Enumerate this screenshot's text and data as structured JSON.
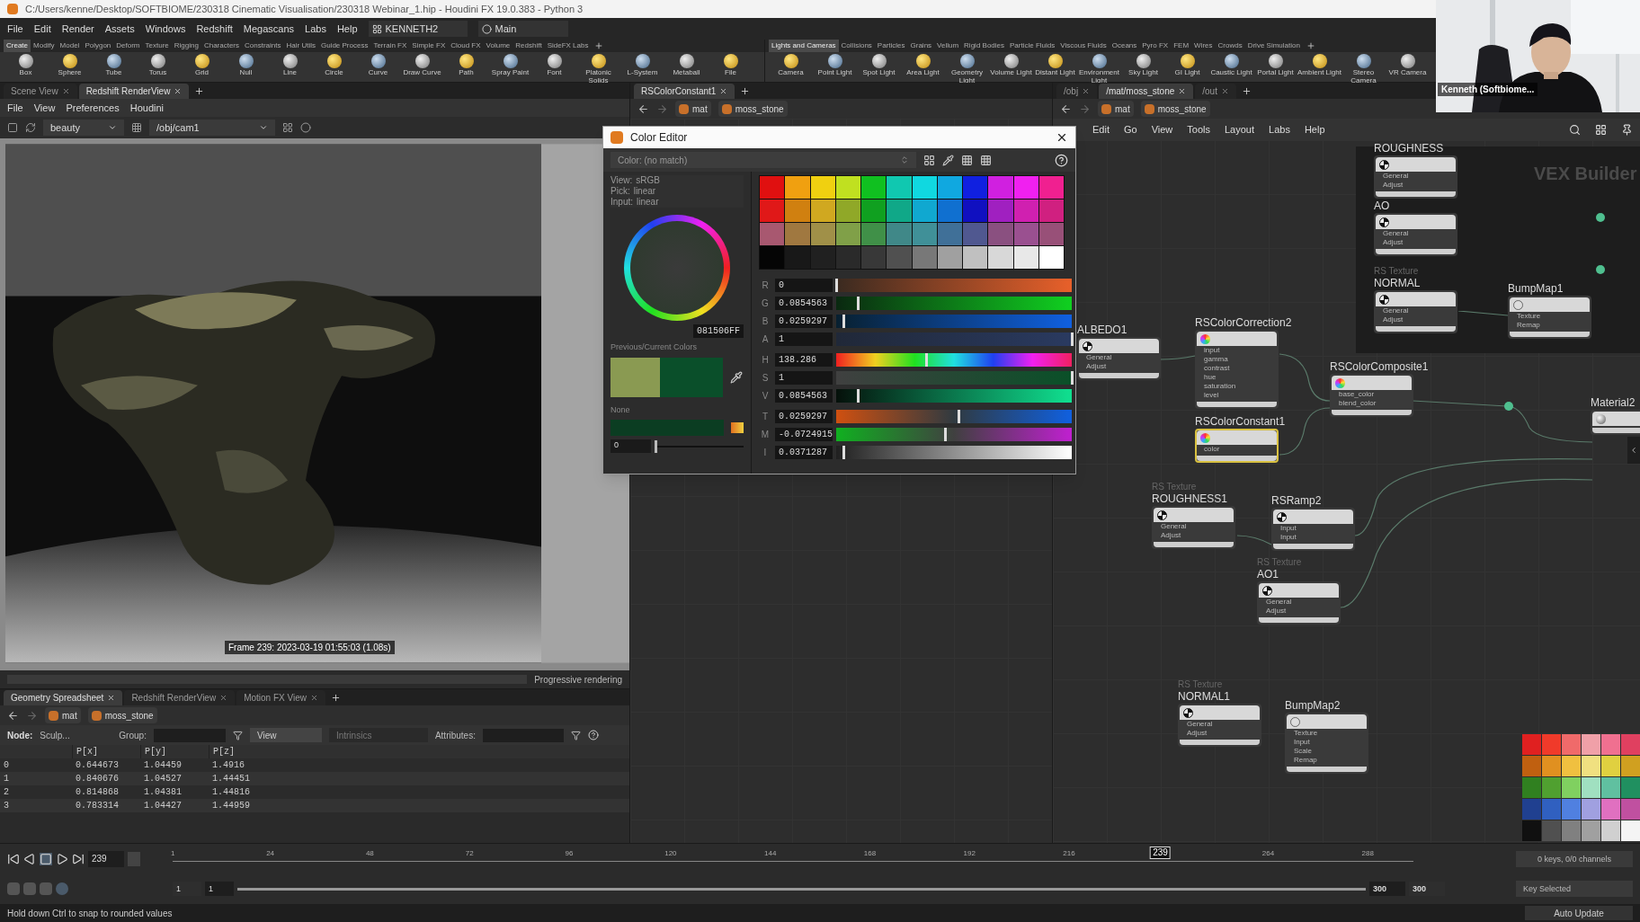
{
  "title_bar": {
    "title": "C:/Users/kenne/Desktop/SOFTBIOME/230318 Cinematic Visualisation/230318 Webinar_1.hip - Houdini FX 19.0.383 - Python 3"
  },
  "menu_bar": {
    "items": [
      "File",
      "Edit",
      "Render",
      "Assets",
      "Windows",
      "Redshift",
      "Megascans",
      "Labs",
      "Help"
    ],
    "desktop": "KENNETH2",
    "layout": "Main"
  },
  "shelf_left": {
    "tabs": [
      {
        "label": "Create",
        "selected": true
      },
      {
        "label": "Modify",
        "selected": false
      },
      {
        "label": "Model",
        "selected": false
      },
      {
        "label": "Polygon",
        "selected": false
      },
      {
        "label": "Deform",
        "selected": false
      },
      {
        "label": "Texture",
        "selected": false
      },
      {
        "label": "Rigging",
        "selected": false
      },
      {
        "label": "Characters",
        "selected": false
      },
      {
        "label": "Constraints",
        "selected": false
      },
      {
        "label": "Hair Utils",
        "selected": false
      },
      {
        "label": "Guide Process",
        "selected": false
      },
      {
        "label": "Terrain FX",
        "selected": false
      },
      {
        "label": "Simple FX",
        "selected": false
      },
      {
        "label": "Cloud FX",
        "selected": false
      },
      {
        "label": "Volume",
        "selected": false
      },
      {
        "label": "Redshift",
        "selected": false
      },
      {
        "label": "SideFX Labs",
        "selected": false
      }
    ],
    "tools": [
      "Box",
      "Sphere",
      "Tube",
      "Torus",
      "Grid",
      "Null",
      "Line",
      "Circle",
      "Curve",
      "Draw Curve",
      "Path",
      "Spray Paint",
      "Font",
      "Platonic Solids",
      "L-System",
      "Metaball",
      "File"
    ]
  },
  "shelf_right": {
    "tabs": [
      {
        "label": "Lights and Cameras",
        "selected": true
      },
      {
        "label": "Collisions",
        "selected": false
      },
      {
        "label": "Particles",
        "selected": false
      },
      {
        "label": "Grains",
        "selected": false
      },
      {
        "label": "Vellum",
        "selected": false
      },
      {
        "label": "Rigid Bodies",
        "selected": false
      },
      {
        "label": "Particle Fluids",
        "selected": false
      },
      {
        "label": "Viscous Fluids",
        "selected": false
      },
      {
        "label": "Oceans",
        "selected": false
      },
      {
        "label": "Pyro FX",
        "selected": false
      },
      {
        "label": "FEM",
        "selected": false
      },
      {
        "label": "Wires",
        "selected": false
      },
      {
        "label": "Crowds",
        "selected": false
      },
      {
        "label": "Drive Simulation",
        "selected": false
      }
    ],
    "tools": [
      "Camera",
      "Point Light",
      "Spot Light",
      "Area Light",
      "Geometry Light",
      "Volume Light",
      "Distant Light",
      "Environment Light",
      "Sky Light",
      "GI Light",
      "Caustic Light",
      "Portal Light",
      "Ambient Light",
      "Stereo Camera",
      "VR Camera"
    ]
  },
  "webcam": {
    "caption": "Kenneth (Softbiome..."
  },
  "render_pane": {
    "tabs": [
      {
        "label": "Scene View",
        "selected": false
      },
      {
        "label": "Redshift RenderView",
        "selected": true
      }
    ],
    "menu": [
      "File",
      "View",
      "Preferences",
      "Houdini"
    ],
    "aov": "beauty",
    "camera": "/obj/cam1",
    "frame_info": "Frame 239: 2023-03-19 01:55:03 (1.08s)",
    "progress": {
      "level": 1.0
    },
    "status": "Progressive rendering"
  },
  "param_pane": {
    "tabs": [
      {
        "label": "RSColorConstant1",
        "selected": true
      }
    ],
    "path": [
      "mat",
      "moss_stone"
    ]
  },
  "network_pane": {
    "tabs": [
      {
        "label": "/obj",
        "selected": false
      },
      {
        "label": "/mat/moss_stone",
        "selected": true
      },
      {
        "label": "/out",
        "selected": false
      }
    ],
    "path": [
      "mat",
      "moss_stone"
    ],
    "menu": [
      "Edit",
      "Go",
      "View",
      "Tools",
      "Layout",
      "Labs",
      "Help"
    ],
    "context": "VEX Builder",
    "nodes": [
      {
        "name": "ROUGHNESS",
        "kind": "texture",
        "selected": false,
        "inputs": [
          "General",
          "Adjust"
        ]
      },
      {
        "name": "AO",
        "kind": "texture",
        "selected": false,
        "inputs": [
          "General",
          "Adjust"
        ]
      },
      {
        "subtitle": "RS Texture",
        "name": "NORMAL",
        "kind": "texture",
        "selected": false,
        "inputs": [
          "General",
          "Adjust"
        ]
      },
      {
        "name": "BumpMap1",
        "kind": "bump",
        "selected": false,
        "inputs": [
          "Texture",
          "Remap"
        ]
      },
      {
        "name": "ALBEDO1",
        "kind": "texture",
        "selected": false,
        "inputs": [
          "General",
          "Adjust"
        ]
      },
      {
        "name": "RSColorCorrection2",
        "kind": "color",
        "selected": false,
        "inputs": [
          "input",
          "gamma",
          "contrast",
          "hue",
          "saturation",
          "level"
        ]
      },
      {
        "name": "RSColorComposite1",
        "kind": "color",
        "selected": false,
        "inputs": [
          "base_color",
          "blend_color"
        ]
      },
      {
        "name": "RSColorConstant1",
        "kind": "color",
        "selected": true,
        "inputs": [
          "color"
        ]
      },
      {
        "name": "Material2",
        "kind": "material",
        "selected": false
      },
      {
        "subtitle": "RS Texture",
        "name": "ROUGHNESS1",
        "kind": "texture",
        "selected": false,
        "inputs": [
          "General",
          "Adjust"
        ]
      },
      {
        "name": "RSRamp2",
        "kind": "texture",
        "selected": false,
        "inputs": [
          "Input",
          "Input"
        ]
      },
      {
        "subtitle": "RS Texture",
        "name": "AO1",
        "kind": "texture",
        "selected": false,
        "inputs": [
          "General",
          "Adjust"
        ]
      },
      {
        "subtitle": "RS Texture",
        "name": "NORMAL1",
        "kind": "texture",
        "selected": false,
        "inputs": [
          "General",
          "Adjust"
        ]
      },
      {
        "name": "BumpMap2",
        "kind": "bump",
        "selected": false,
        "inputs": [
          "Texture",
          "Input",
          "Scale",
          "Remap"
        ]
      }
    ],
    "palette": [
      {
        "color": "#e02020"
      },
      {
        "color": "#f03a2a"
      },
      {
        "color": "#f06a6a"
      },
      {
        "color": "#f0a0a8"
      },
      {
        "color": "#f07090"
      },
      {
        "color": "#e04060"
      },
      {
        "color": "#c06010"
      },
      {
        "color": "#e09020"
      },
      {
        "color": "#f0c040"
      },
      {
        "color": "#f0e080"
      },
      {
        "color": "#e0d040"
      },
      {
        "color": "#d0a020"
      },
      {
        "color": "#308020"
      },
      {
        "color": "#50a030"
      },
      {
        "color": "#80d060"
      },
      {
        "color": "#a0e0c0"
      },
      {
        "color": "#60c0a0"
      },
      {
        "color": "#209060"
      },
      {
        "color": "#204090"
      },
      {
        "color": "#3060c0"
      },
      {
        "color": "#5080e0"
      },
      {
        "color": "#a0a0e0"
      },
      {
        "color": "#e070c0"
      },
      {
        "color": "#c050a0"
      },
      {
        "color": "#101010"
      },
      {
        "color": "#505050"
      },
      {
        "color": "#808080"
      },
      {
        "color": "#a0a0a0"
      },
      {
        "color": "#d0d0d0"
      },
      {
        "color": "#f4f4f4"
      }
    ]
  },
  "color_editor": {
    "title": "Color Editor",
    "preset": "Color: (no match)",
    "info": [
      {
        "label": "View:",
        "value": "sRGB"
      },
      {
        "label": "Pick:",
        "value": "linear"
      },
      {
        "label": "Input:",
        "value": "linear"
      }
    ],
    "hex": "081506FF",
    "history_label": "Previous/Current Colors",
    "previous": {
      "color": "#8a9a52"
    },
    "current": {
      "color": "#0a4f2a"
    },
    "swatch": {
      "label": "None",
      "color": "#0b3d22",
      "value": "0",
      "level": 0.0
    },
    "palette": [
      {
        "color": "#e01010"
      },
      {
        "color": "#f0a010"
      },
      {
        "color": "#f0d010"
      },
      {
        "color": "#c0e020"
      },
      {
        "color": "#10c020"
      },
      {
        "color": "#10c8b0"
      },
      {
        "color": "#10d8e0"
      },
      {
        "color": "#10a8e0"
      },
      {
        "color": "#1020e0"
      },
      {
        "color": "#d020e0"
      },
      {
        "color": "#f020f0"
      },
      {
        "color": "#f02090"
      },
      {
        "color": "#e01818"
      },
      {
        "color": "#d08010"
      },
      {
        "color": "#d0a820"
      },
      {
        "color": "#90a828"
      },
      {
        "color": "#10a020"
      },
      {
        "color": "#10a888"
      },
      {
        "color": "#10a8d0"
      },
      {
        "color": "#1070d0"
      },
      {
        "color": "#1010c0"
      },
      {
        "color": "#a020c0"
      },
      {
        "color": "#d020b0"
      },
      {
        "color": "#d02080"
      },
      {
        "color": "#a85870"
      },
      {
        "color": "#a07840"
      },
      {
        "color": "#a09048"
      },
      {
        "color": "#80a048"
      },
      {
        "color": "#409048"
      },
      {
        "color": "#408888"
      },
      {
        "color": "#409098"
      },
      {
        "color": "#407098"
      },
      {
        "color": "#505890"
      },
      {
        "color": "#8a5080"
      },
      {
        "color": "#9a5090"
      },
      {
        "color": "#985078"
      },
      {
        "color": "#050505"
      },
      {
        "color": "#181818"
      },
      {
        "color": "#202020"
      },
      {
        "color": "#2a2a2a"
      },
      {
        "color": "#383838"
      },
      {
        "color": "#505050"
      },
      {
        "color": "#787878"
      },
      {
        "color": "#a0a0a0"
      },
      {
        "color": "#c0c0c0"
      },
      {
        "color": "#d8d8d8"
      },
      {
        "color": "#e8e8e8"
      },
      {
        "color": "#ffffff"
      }
    ],
    "channels": [
      {
        "label": "R",
        "value": "0",
        "level": 0.0
      },
      {
        "label": "G",
        "value": "0.0854563",
        "level": 0.09
      },
      {
        "label": "B",
        "value": "0.0259297",
        "level": 0.03
      },
      {
        "label": "A",
        "value": "1",
        "level": 1.0
      },
      {
        "label": "H",
        "value": "138.286",
        "level": 0.38
      },
      {
        "label": "S",
        "value": "1",
        "level": 1.0
      },
      {
        "label": "V",
        "value": "0.0854563",
        "level": 0.09
      },
      {
        "label": "T",
        "value": "0.0259297",
        "level": 0.52
      },
      {
        "label": "M",
        "value": "-0.0724915",
        "level": 0.46
      },
      {
        "label": "I",
        "value": "0.0371287",
        "level": 0.03
      }
    ]
  },
  "spreadsheet": {
    "tabs": [
      {
        "label": "Geometry Spreadsheet",
        "selected": true
      },
      {
        "label": "Redshift RenderView",
        "selected": false
      },
      {
        "label": "Motion FX View",
        "selected": false
      }
    ],
    "path": [
      "mat",
      "moss_stone"
    ],
    "node_label": "Node:",
    "node": "Sculp...",
    "group_label": "Group:",
    "view": "View",
    "intrinsics": "Intrinsics",
    "attributes_label": "Attributes:",
    "columns": [
      "P[x]",
      "P[y]",
      "P[z]"
    ],
    "rows": [
      {
        "point": "0",
        "cells": [
          "0.644673",
          "1.04459",
          "1.4916"
        ]
      },
      {
        "point": "1",
        "cells": [
          "0.840676",
          "1.04527",
          "1.44451"
        ]
      },
      {
        "point": "2",
        "cells": [
          "0.814868",
          "1.04381",
          "1.44816"
        ]
      },
      {
        "point": "3",
        "cells": [
          "0.783314",
          "1.04427",
          "1.44959"
        ]
      }
    ]
  },
  "timeline": {
    "frame": "239",
    "ticks": [
      "1",
      "24",
      "48",
      "72",
      "96",
      "120",
      "144",
      "168",
      "192",
      "216",
      "264",
      "288"
    ],
    "current": "239",
    "level": 0.796,
    "start": "1",
    "start_range": "1",
    "end_range": "300",
    "end": "300",
    "keys": "0 keys, 0/0 channels",
    "key_mode": "Key Selected"
  },
  "status_bar": {
    "message": "Hold down Ctrl to snap to rounded values",
    "update": "Auto Update"
  }
}
